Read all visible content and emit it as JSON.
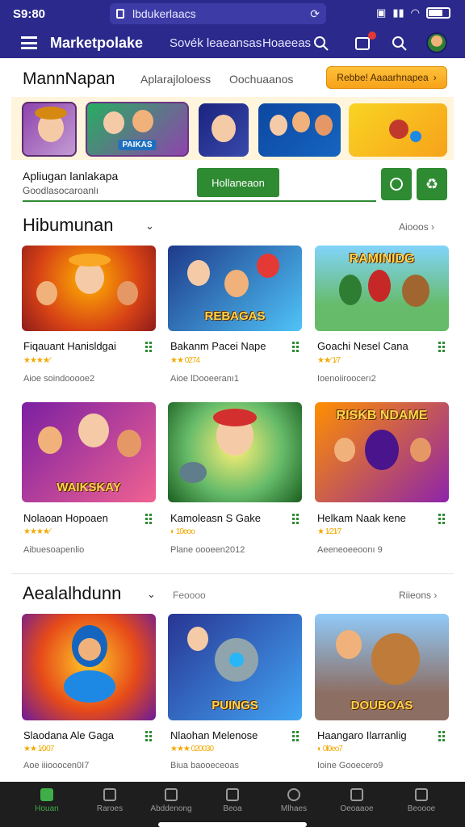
{
  "status": {
    "time": "S9:80",
    "url": "lbdukerlaacs"
  },
  "header": {
    "brand": "Marketpolake",
    "link1": "Sovék leaeansas",
    "link2": "Hoaeeas"
  },
  "marketplace": {
    "title": "MannNapan",
    "tab1": "Aplarajloloess",
    "tab2": "Oochuaanos",
    "promo": "Rebbe! Aaaarhnapea"
  },
  "banners": [
    {
      "label": ""
    },
    {
      "label": "PAIKAS"
    },
    {
      "label": ""
    },
    {
      "label": ""
    },
    {
      "label": ""
    }
  ],
  "app": {
    "name": "Apliugan lanlakapa",
    "sub": "Goodlasocaroanlı",
    "install": "Hollaneaon"
  },
  "section1": {
    "title": "Hibumunan",
    "right": "Aiooos"
  },
  "section2": {
    "title": "Aealalhdunn",
    "mid": "Feoooo",
    "right": "Riieons"
  },
  "cards1": [
    {
      "name": "Fiqauant Hanisldgai",
      "stars": "★★★★⁄",
      "meta": "Aioe soindooooe2",
      "art": ""
    },
    {
      "name": "Bakanm Pacei Nape",
      "stars": "★★ 0274",
      "meta": "Aioe lDooeeranı1",
      "art": "REBAGAS"
    },
    {
      "name": "Goachi Nesel Cana",
      "stars": "★★⁄ 1⁄7",
      "meta": "Ioenoiiroocerı2",
      "art": "RAMINIDG"
    }
  ],
  "cards2": [
    {
      "name": "Nolaoan Hopoaen",
      "stars": "★★★★⁄",
      "meta": "Aibuesoapenlio",
      "art": "WAIKSKAY"
    },
    {
      "name": "Kamoleasn S Gake",
      "stars": "◐ 10eoo",
      "meta": "Plane oooeen2012",
      "art": ""
    },
    {
      "name": "Helkam Naak kene",
      "stars": "★ 1⁄21⁄7",
      "meta": "Aeeneoeeoonı 9",
      "art": "RISKB NDAME"
    }
  ],
  "cards3": [
    {
      "name": "Slaodana Ale Gaga",
      "stars": "★★ 1⁄0⁄07",
      "meta": "Aoe iiiooocen0I7",
      "art": ""
    },
    {
      "name": "Nlaohan Melenose",
      "stars": "★★★ 020030",
      "meta": "Biua baooeceoas",
      "art": "PUINGS"
    },
    {
      "name": "Haangaro Ilarranlig",
      "stars": "◐ 0l0eo7",
      "meta": "Ioine Gooecero9",
      "art": "DOUBOAS"
    }
  ],
  "nav": [
    {
      "label": "Houan"
    },
    {
      "label": "Raroes"
    },
    {
      "label": "Abddenong"
    },
    {
      "label": "Beoa"
    },
    {
      "label": "Mlhaes"
    },
    {
      "label": "Oeoaaoe"
    },
    {
      "label": "Beoooe"
    }
  ],
  "colors": {
    "header": "#2b2a8c",
    "accent": "#2e8b32",
    "promo": "#f7a21a",
    "nav": "#1e1e1e"
  }
}
